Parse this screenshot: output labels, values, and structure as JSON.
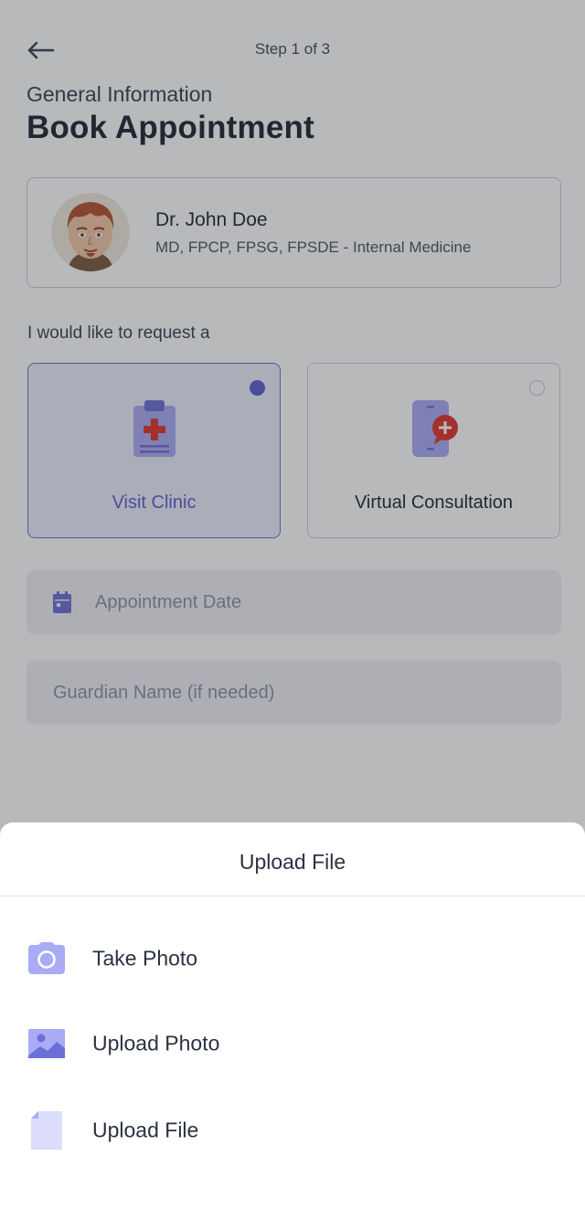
{
  "header": {
    "step": "Step 1 of 3",
    "section": "General Information",
    "title": "Book Appointment"
  },
  "doctor": {
    "name": "Dr. John Doe",
    "credentials": "MD, FPCP, FPSG, FPSDE - Internal Medicine"
  },
  "request": {
    "label": "I would like to request a",
    "options": [
      {
        "label": "Visit Clinic",
        "selected": true,
        "icon": "clipboard-medical-icon"
      },
      {
        "label": "Virtual Consultation",
        "selected": false,
        "icon": "phone-consult-icon"
      }
    ]
  },
  "form": {
    "date_placeholder": "Appointment Date",
    "guardian_placeholder": "Guardian Name (if needed)"
  },
  "sheet": {
    "title": "Upload File",
    "items": [
      {
        "label": "Take Photo",
        "icon": "camera-icon"
      },
      {
        "label": "Upload Photo",
        "icon": "image-icon"
      },
      {
        "label": "Upload File",
        "icon": "file-icon"
      }
    ]
  },
  "colors": {
    "accent": "#5b5fd0",
    "icon_fill": "#aaabf5",
    "medical_red": "#e0342b",
    "selected_bg": "#eceefb",
    "overlay": "rgba(40,42,48,0.33)"
  }
}
